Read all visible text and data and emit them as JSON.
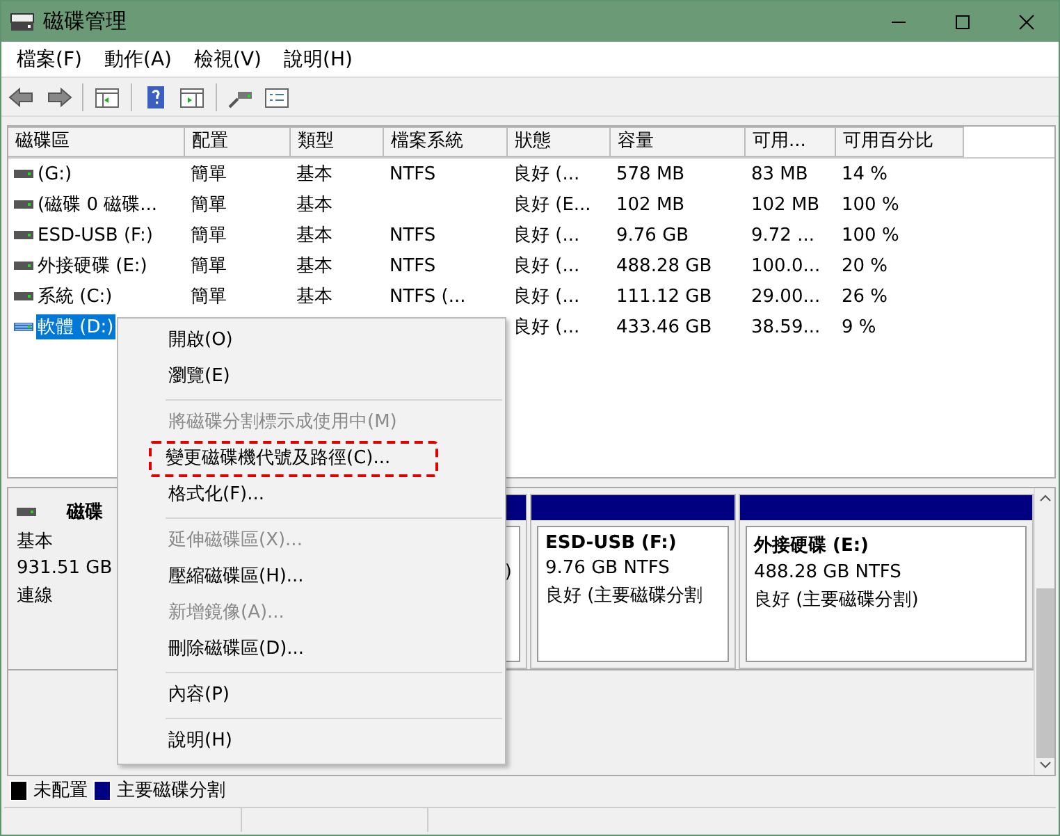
{
  "window": {
    "title": "磁碟管理"
  },
  "menu_bar": [
    "檔案(F)",
    "動作(A)",
    "檢視(V)",
    "說明(H)"
  ],
  "table": {
    "columns": [
      "磁碟區",
      "配置",
      "類型",
      "檔案系統",
      "狀態",
      "容量",
      "可用...",
      "可用百分比"
    ],
    "rows": [
      {
        "cells": [
          " (G:)",
          "簡單",
          "基本",
          "NTFS",
          "良好 (...",
          "578 MB",
          "83 MB",
          "14 %"
        ],
        "selected": false
      },
      {
        "cells": [
          "(磁碟 0 磁碟...",
          "簡單",
          "基本",
          "",
          "良好 (E...",
          "102 MB",
          "102 MB",
          "100 %"
        ],
        "selected": false
      },
      {
        "cells": [
          "ESD-USB (F:)",
          "簡單",
          "基本",
          "NTFS",
          "良好 (...",
          "9.76 GB",
          "9.72 ...",
          "100 %"
        ],
        "selected": false
      },
      {
        "cells": [
          "外接硬碟 (E:)",
          "簡單",
          "基本",
          "NTFS",
          "良好 (...",
          "488.28 GB",
          "100.0...",
          "20 %"
        ],
        "selected": false
      },
      {
        "cells": [
          "系統 (C:)",
          "簡單",
          "基本",
          "NTFS (...",
          "良好 (...",
          "111.12 GB",
          "29.00...",
          "26 %"
        ],
        "selected": false
      },
      {
        "cells": [
          "軟體 (D:)",
          "",
          "",
          "",
          "良好 (...",
          "433.46 GB",
          "38.59...",
          "9 %"
        ],
        "selected": true
      }
    ]
  },
  "context_menu": [
    {
      "kind": "item",
      "label": "開啟(O)",
      "disabled": false,
      "outlined": false
    },
    {
      "kind": "item",
      "label": "瀏覽(E)",
      "disabled": false,
      "outlined": false
    },
    {
      "kind": "separator"
    },
    {
      "kind": "item",
      "label": "將磁碟分割標示成使用中(M)",
      "disabled": true,
      "outlined": false
    },
    {
      "kind": "item",
      "label": "變更磁碟機代號及路徑(C)...",
      "disabled": false,
      "outlined": true
    },
    {
      "kind": "item",
      "label": "格式化(F)...",
      "disabled": false,
      "outlined": false
    },
    {
      "kind": "separator"
    },
    {
      "kind": "item",
      "label": "延伸磁碟區(X)...",
      "disabled": true,
      "outlined": false
    },
    {
      "kind": "item",
      "label": "壓縮磁碟區(H)...",
      "disabled": false,
      "outlined": false
    },
    {
      "kind": "item",
      "label": "新增鏡像(A)...",
      "disabled": true,
      "outlined": false
    },
    {
      "kind": "item",
      "label": "刪除磁碟區(D)...",
      "disabled": false,
      "outlined": false
    },
    {
      "kind": "separator"
    },
    {
      "kind": "item",
      "label": "內容(P)",
      "disabled": false,
      "outlined": false
    },
    {
      "kind": "separator"
    },
    {
      "kind": "item",
      "label": "說明(H)",
      "disabled": false,
      "outlined": false
    }
  ],
  "disk": {
    "name": "磁碟",
    "lines": [
      "基本",
      "931.51 GB",
      "連線"
    ],
    "partitions": [
      {
        "kind": "partial",
        "lines": [
          ")"
        ]
      },
      {
        "kind": "full",
        "name": "ESD-USB  (F:)",
        "lines": [
          "9.76 GB NTFS",
          "良好 (主要磁碟分割"
        ]
      },
      {
        "kind": "full",
        "name": "外接硬碟  (E:)",
        "lines": [
          "488.28 GB NTFS",
          "良好 (主要磁碟分割)"
        ]
      }
    ]
  },
  "legend": [
    {
      "label": "未配置",
      "color": "#000000"
    },
    {
      "label": "主要磁碟分割",
      "color": "#000080"
    }
  ]
}
